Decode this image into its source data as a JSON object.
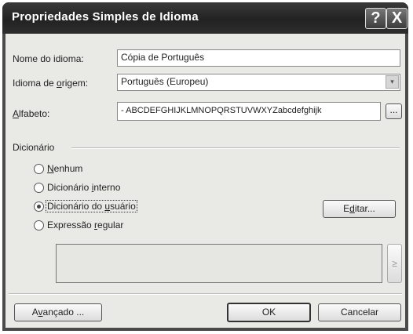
{
  "window": {
    "title": "Propriedades Simples de Idioma",
    "help_glyph": "?",
    "close_glyph": "X"
  },
  "fields": {
    "language_name": {
      "label": "Nome do idioma:",
      "value": "Cópia de Português"
    },
    "source_language": {
      "label_pre": "Idioma de ",
      "label_key": "o",
      "label_post": "rigem:",
      "value": "Português (Europeu)",
      "dropdown_glyph": "▾"
    },
    "alphabet": {
      "label_key": "A",
      "label_post": "lfabeto:",
      "value": "- ABCDEFGHIJKLMNOPQRSTUVWXYZabcdefghijk",
      "browse_label": "..."
    }
  },
  "dictionary": {
    "group_label": "Dicionário",
    "options": [
      {
        "label_key": "N",
        "label_post": "enhum",
        "selected": false
      },
      {
        "label_pre": "Dicionário ",
        "label_key": "i",
        "label_post": "nterno",
        "selected": false
      },
      {
        "label_pre": "Dicionário do ",
        "label_key": "u",
        "label_post": "suário",
        "selected": true
      },
      {
        "label_pre": "Expressão ",
        "label_key": "r",
        "label_post": "egular",
        "selected": false
      }
    ],
    "edit_label_pre": "E",
    "edit_label_key": "d",
    "edit_label_post": "itar...",
    "regex_side_glyph": "≥"
  },
  "buttons": {
    "advanced_pre": "A",
    "advanced_key": "v",
    "advanced_post": "ançado ...",
    "ok": "OK",
    "cancel": "Cancelar"
  }
}
